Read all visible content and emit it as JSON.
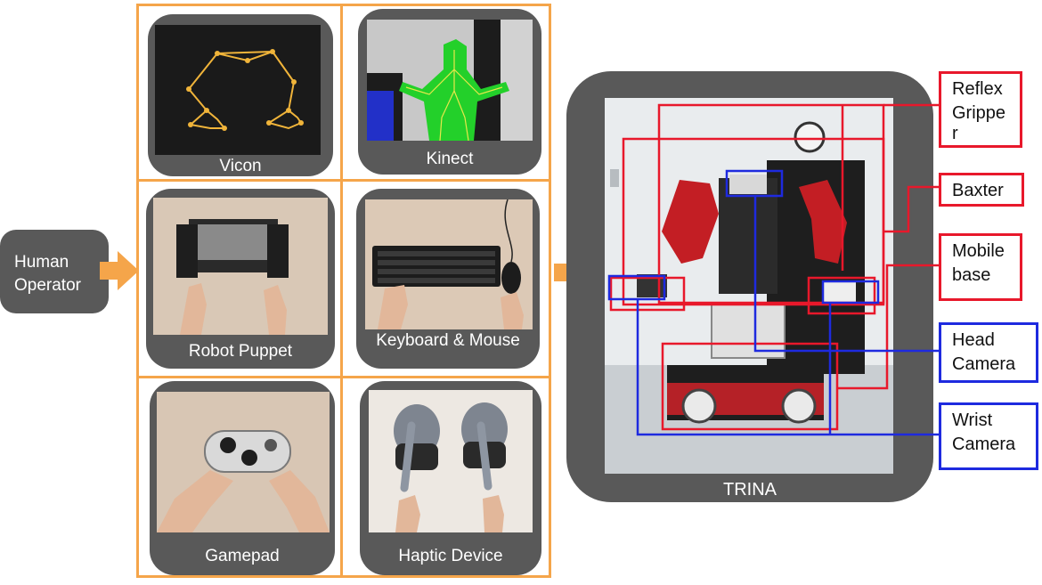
{
  "operator": {
    "label_line1": "Human",
    "label_line2": "Operator"
  },
  "devices": [
    {
      "id": "vicon",
      "label": "Vicon"
    },
    {
      "id": "kinect",
      "label": "Kinect"
    },
    {
      "id": "robot-puppet",
      "label": "Robot Puppet"
    },
    {
      "id": "keyboard-mouse",
      "label": "Keyboard  & Mouse"
    },
    {
      "id": "gamepad",
      "label": "Gamepad"
    },
    {
      "id": "haptic",
      "label": "Haptic Device"
    }
  ],
  "robot": {
    "label": "TRINA"
  },
  "callouts": {
    "reflex_gripper": {
      "line1": "Reflex",
      "line2": "Grippe",
      "line3": "r"
    },
    "baxter": {
      "line1": "Baxter"
    },
    "mobile_base": {
      "line1": "Mobile",
      "line2": "base"
    },
    "head_camera": {
      "line1": "Head",
      "line2": "Camera"
    },
    "wrist_camera": {
      "line1": "Wrist",
      "line2": "Camera"
    }
  },
  "colors": {
    "orange": "#f5a54a",
    "grey": "#595959",
    "red": "#e8182b",
    "blue": "#1e2adf"
  }
}
